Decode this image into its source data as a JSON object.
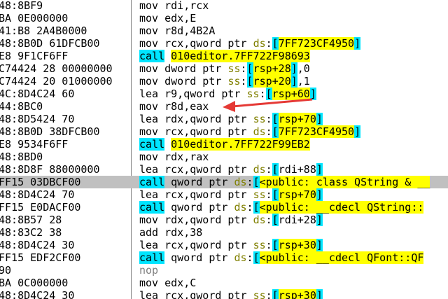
{
  "rows": [
    {
      "bytes": "48:8BF9",
      "mn": "mov",
      "ops": "rdi,rcx"
    },
    {
      "bytes": "BA 0E000000",
      "mn": "mov",
      "ops": "edx,E"
    },
    {
      "bytes": "41:B8 2A4B0000",
      "mn": "mov",
      "ops": "r8d,4B2A"
    },
    {
      "bytes": "48:8B0D 61DFCB00",
      "mn": "mov",
      "ops": "rcx,qword ptr ds:[7FF723CF4950]"
    },
    {
      "bytes": "E8 9F1CF6FF",
      "mn": "call",
      "ops": "010editor.7FF722F98693"
    },
    {
      "bytes": "C74424 28 00000000",
      "mn": "mov",
      "ops": "dword ptr ss:[rsp+28],0"
    },
    {
      "bytes": "C74424 20 01000000",
      "mn": "mov",
      "ops": "dword ptr ss:[rsp+20],1"
    },
    {
      "bytes": "4C:8D4C24 60",
      "mn": "lea",
      "ops": "r9,qword ptr ss:[rsp+60]"
    },
    {
      "bytes": "44:8BC0",
      "mn": "mov",
      "ops": "r8d,eax"
    },
    {
      "bytes": "48:8D5424 70",
      "mn": "lea",
      "ops": "rdx,qword ptr ss:[rsp+70]"
    },
    {
      "bytes": "48:8B0D 38DFCB00",
      "mn": "mov",
      "ops": "rcx,qword ptr ds:[7FF723CF4950]"
    },
    {
      "bytes": "E8 9534F6FF",
      "mn": "call",
      "ops": "010editor.7FF722F99EB2"
    },
    {
      "bytes": "48:8BD0",
      "mn": "mov",
      "ops": "rdx,rax"
    },
    {
      "bytes": "48:8D8F 88000000",
      "mn": "lea",
      "ops": "rcx,qword ptr ds:[rdi+88]"
    },
    {
      "bytes": "FF15 03DBCF00",
      "mn": "call",
      "ops": "qword ptr ds:[<public: class QString & __"
    },
    {
      "bytes": "48:8D4C24 70",
      "mn": "lea",
      "ops": "rcx,qword ptr ss:[rsp+70]"
    },
    {
      "bytes": "FF15 E0DACF00",
      "mn": "call",
      "ops": "qword ptr ds:[<public: __cdecl QString::"
    },
    {
      "bytes": "48:8B57 28",
      "mn": "mov",
      "ops": "rdx,qword ptr ds:[rdi+28]"
    },
    {
      "bytes": "48:83C2 38",
      "mn": "add",
      "ops": "rdx,38"
    },
    {
      "bytes": "48:8D4C24 30",
      "mn": "lea",
      "ops": "rcx,qword ptr ss:[rsp+30]"
    },
    {
      "bytes": "FF15 EDF2CF00",
      "mn": "call",
      "ops": "qword ptr ds:[<public: __cdecl QFont::QF"
    },
    {
      "bytes": "90",
      "mn": "nop",
      "ops": ""
    },
    {
      "bytes": "BA 0C000000",
      "mn": "mov",
      "ops": "edx,C"
    },
    {
      "bytes": "48:8D4C24 30",
      "mn": "lea",
      "ops": "rcx,qword ptr ss:[rsp+30]"
    }
  ],
  "selected_row": 14,
  "colors": {
    "call_bg": "#00e5ff",
    "highlight_bg": "#ffff00",
    "selection_bg": "#c0c0c0",
    "arrow": "#e53935"
  }
}
